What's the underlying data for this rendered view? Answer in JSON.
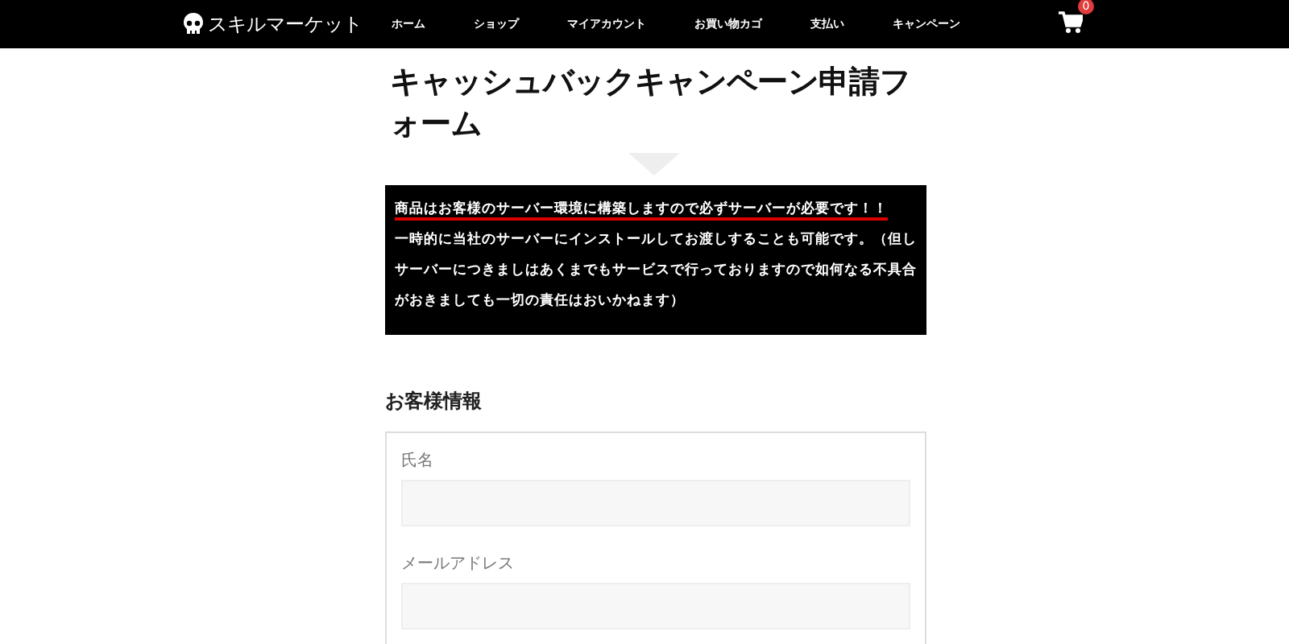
{
  "header": {
    "logo": "スキルマーケット",
    "nav": [
      {
        "label": "ホーム"
      },
      {
        "label": "ショップ"
      },
      {
        "label": "マイアカウント"
      },
      {
        "label": "お買い物カゴ"
      },
      {
        "label": "支払い"
      },
      {
        "label": "キャンペーン"
      }
    ],
    "cart_count": "0"
  },
  "title": "キャッシュバックキャンペーン申請フォーム",
  "notice": {
    "headline": "商品はお客様のサーバー環境に構築しますので必ずサーバーが必要です！！",
    "text": "一時的に当社のサーバーにインストールしてお渡しすることも可能です。（但しサーバーにつきましはあくまでもサービスで行っておりますので如何なる不具合がおきましても一切の責任はおいかねます）"
  },
  "section": {
    "heading": "お客様情報",
    "fields": [
      {
        "label": "氏名"
      },
      {
        "label": "メールアドレス"
      }
    ]
  }
}
